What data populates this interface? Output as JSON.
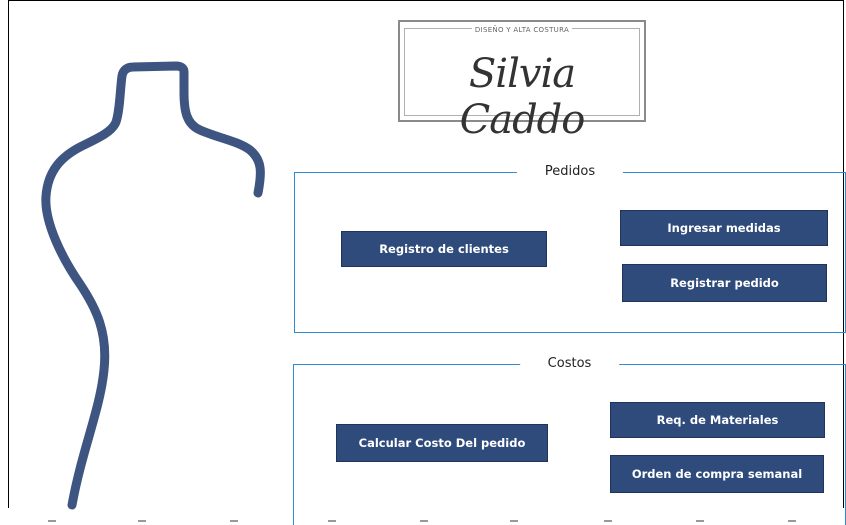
{
  "logo": {
    "tagline": "DISEÑO Y ALTA COSTURA",
    "name": "Silvia Caddo"
  },
  "pedidos": {
    "title": "Pedidos",
    "buttons": {
      "registro_clientes": "Registro de clientes",
      "ingresar_medidas": "Ingresar medidas",
      "registrar_pedido": "Registrar pedido"
    }
  },
  "costos": {
    "title": "Costos",
    "buttons": {
      "calcular_costo": "Calcular Costo Del pedido",
      "req_materiales": "Req. de Materiales",
      "orden_compra": "Orden de compra semanal"
    }
  },
  "colors": {
    "button_bg": "#2f4b7c",
    "group_border": "#2e8bd0",
    "mannequin": "#3d5580"
  }
}
